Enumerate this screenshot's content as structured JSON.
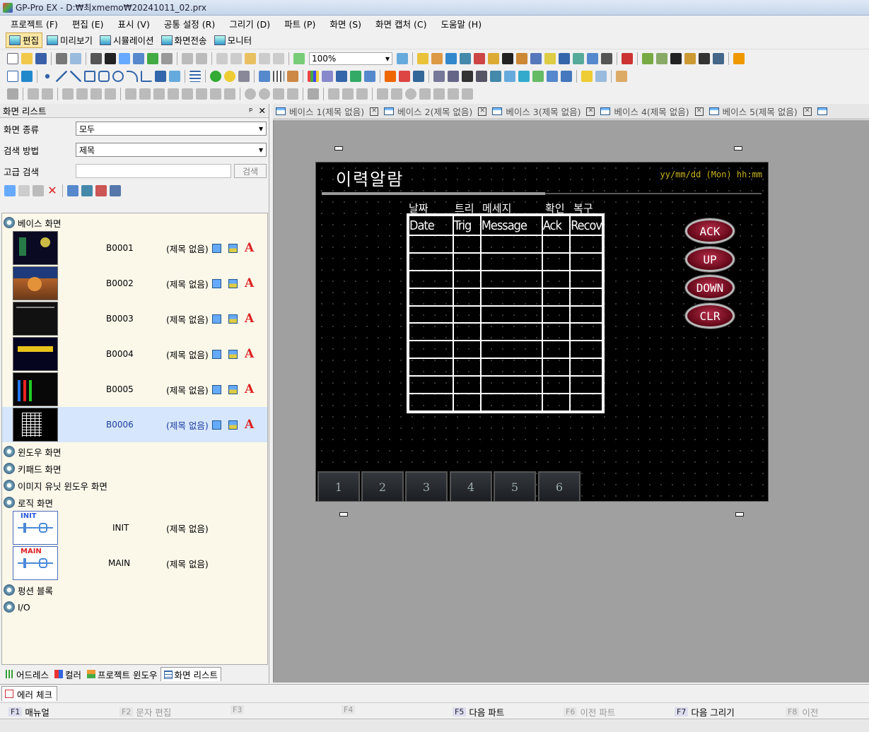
{
  "window": {
    "title": "GP-Pro EX - D:₩최xmemo₩20241011_02.prx"
  },
  "menu": [
    "프로젝트 (F)",
    "편집 (E)",
    "표시 (V)",
    "공통 설정 (R)",
    "그리기 (D)",
    "파트 (P)",
    "화면 (S)",
    "화면 캡처 (C)",
    "도움말 (H)"
  ],
  "modes": [
    "편집",
    "미리보기",
    "시뮬레이션",
    "화면전송",
    "모니터"
  ],
  "toolbar": {
    "zoom": "100%"
  },
  "left_panel": {
    "title": "화면 리스트",
    "pin": "ᵖ",
    "close": "✕",
    "screen_type_label": "화면 종류",
    "screen_type_value": "모두",
    "search_method_label": "검색 방법",
    "search_method_value": "제목",
    "advanced_label": "고급 검색",
    "search_button": "검색",
    "tree": {
      "base": "베이스 화면",
      "window": "윈도우 화면",
      "keypad": "키패드 화면",
      "image_unit": "이미지 유닛 윈도우 화면",
      "logic": "로직 화면",
      "function": "펑션 블록",
      "io": "I/O"
    },
    "base_screens": [
      {
        "id": "B0001",
        "title": "(제목 없음)"
      },
      {
        "id": "B0002",
        "title": "(제목 없음)"
      },
      {
        "id": "B0003",
        "title": "(제목 없음)"
      },
      {
        "id": "B0004",
        "title": "(제목 없음)"
      },
      {
        "id": "B0005",
        "title": "(제목 없음)"
      },
      {
        "id": "B0006",
        "title": "(제목 없음)"
      }
    ],
    "logic_screens": [
      {
        "badge": "INIT",
        "id": "INIT",
        "title": "(제목 없음)"
      },
      {
        "badge": "MAIN",
        "id": "MAIN",
        "title": "(제목 없음)"
      }
    ],
    "bottom_tabs": [
      "어드레스",
      "컬러",
      "프로젝트 윈도우",
      "화면 리스트"
    ]
  },
  "doc_tabs": [
    "베이스 1(제목 없음)",
    "베이스 2(제목 없음)",
    "베이스 3(제목 없음)",
    "베이스 4(제목 없음)",
    "베이스 5(제목 없음)"
  ],
  "screen": {
    "title": "이력알람",
    "datetime": "yy/mm/dd (Mon) hh:mm",
    "headers_kr": [
      "날짜",
      "트리",
      "메세지",
      "확인",
      "복구"
    ],
    "headers_en": [
      "Date",
      "Trig",
      "Message",
      "Ack",
      "Recov"
    ],
    "buttons": [
      "ACK",
      "UP",
      "DOWN",
      "CLR"
    ],
    "nav": [
      "1",
      "2",
      "3",
      "4",
      "5",
      "6"
    ]
  },
  "error_tab": "에러 체크",
  "fkeys": [
    {
      "key": "F1",
      "label": "매뉴얼",
      "enabled": true
    },
    {
      "key": "F2",
      "label": "문자 편집",
      "enabled": false
    },
    {
      "key": "F3",
      "label": "",
      "enabled": false
    },
    {
      "key": "F4",
      "label": "",
      "enabled": false
    },
    {
      "key": "F5",
      "label": "다음 파트",
      "enabled": true
    },
    {
      "key": "F6",
      "label": "이전 파트",
      "enabled": false
    },
    {
      "key": "F7",
      "label": "다음 그리기",
      "enabled": true
    },
    {
      "key": "F8",
      "label": "이전",
      "enabled": false
    }
  ],
  "colors": {
    "selected_row": "#d6e6fc",
    "workspace": "#a0a0a0",
    "date_text": "#c8b41e",
    "button_red": "#8e1428"
  }
}
